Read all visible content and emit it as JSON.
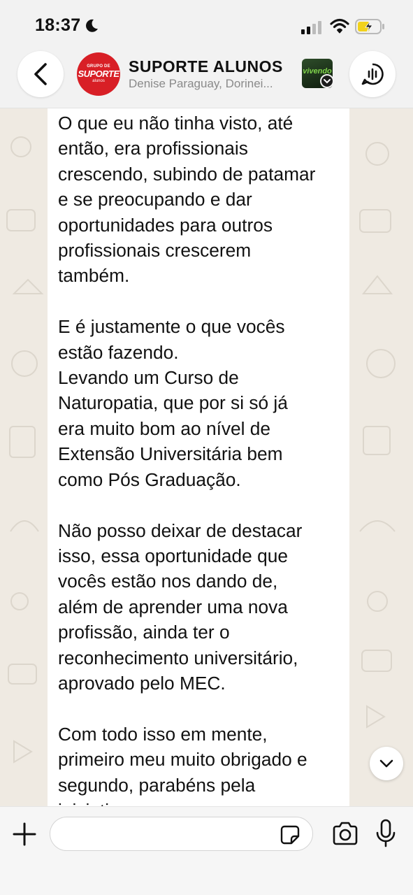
{
  "status_bar": {
    "time": "18:37"
  },
  "header": {
    "back_icon": "chevron-left-icon",
    "avatar_text": {
      "top": "GRUPO DE",
      "mid": "SUPORTE",
      "bottom": "alunos"
    },
    "title": "SUPORTE ALUNOS",
    "subtitle": "Denise Paraguay, Dorinei...",
    "thumbnail_text": "vivendo",
    "call_icon": "group-call-icon"
  },
  "message": {
    "text": "O que eu não tinha visto, até\nentão, era profissionais\ncrescendo, subindo de patamar\ne se preocupando e dar\noportunidades para outros\nprofissionais crescerem\ntambém.\n\nE é justamente o que vocês\nestão fazendo.\nLevando um Curso de\nNaturopatia, que por si só já\nera muito bom ao nível de\nExtensão Universitária bem\ncomo Pós Graduação.\n\nNão posso deixar de destacar\nisso, essa oportunidade que\nvocês estão nos dando de,\nalém de aprender uma nova\nprofissão, ainda ter o\nreconhecimento universitário,\naprovado pelo MEC.\n\nCom todo isso em mente,\nprimeiro meu muito obrigado e\nsegundo, parabéns pela\niniciativa."
  },
  "input_bar": {
    "placeholder": "",
    "icons": [
      "plus-icon",
      "sticker-icon",
      "camera-icon",
      "microphone-icon"
    ]
  },
  "colors": {
    "wallpaper": "#efeae2",
    "bubble": "#ffffff",
    "avatar_red": "#d81f26",
    "bar": "#f2f2f2"
  }
}
